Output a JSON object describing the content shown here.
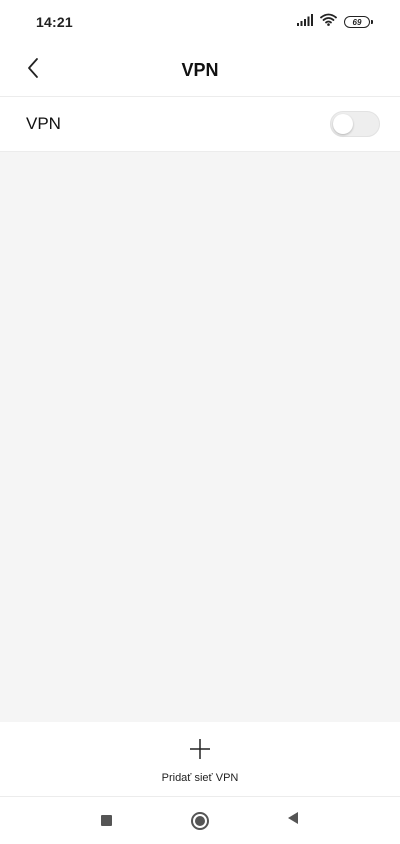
{
  "status_bar": {
    "time": "14:21",
    "battery_level": "69",
    "icons": [
      "signal-icon",
      "wifi-icon",
      "battery-icon"
    ]
  },
  "header": {
    "title": "VPN",
    "back_icon": "chevron-left-icon"
  },
  "vpn_setting": {
    "label": "VPN",
    "enabled": false
  },
  "bottom_action": {
    "icon": "plus-icon",
    "label": "Pridať sieť VPN"
  },
  "nav_bar": {
    "buttons": [
      "recents-square-icon",
      "home-circle-icon",
      "back-triangle-icon"
    ]
  },
  "colors": {
    "background": "#ffffff",
    "content_background": "#f5f5f5",
    "divider": "#ececec",
    "toggle_off": "#eeeeee"
  }
}
